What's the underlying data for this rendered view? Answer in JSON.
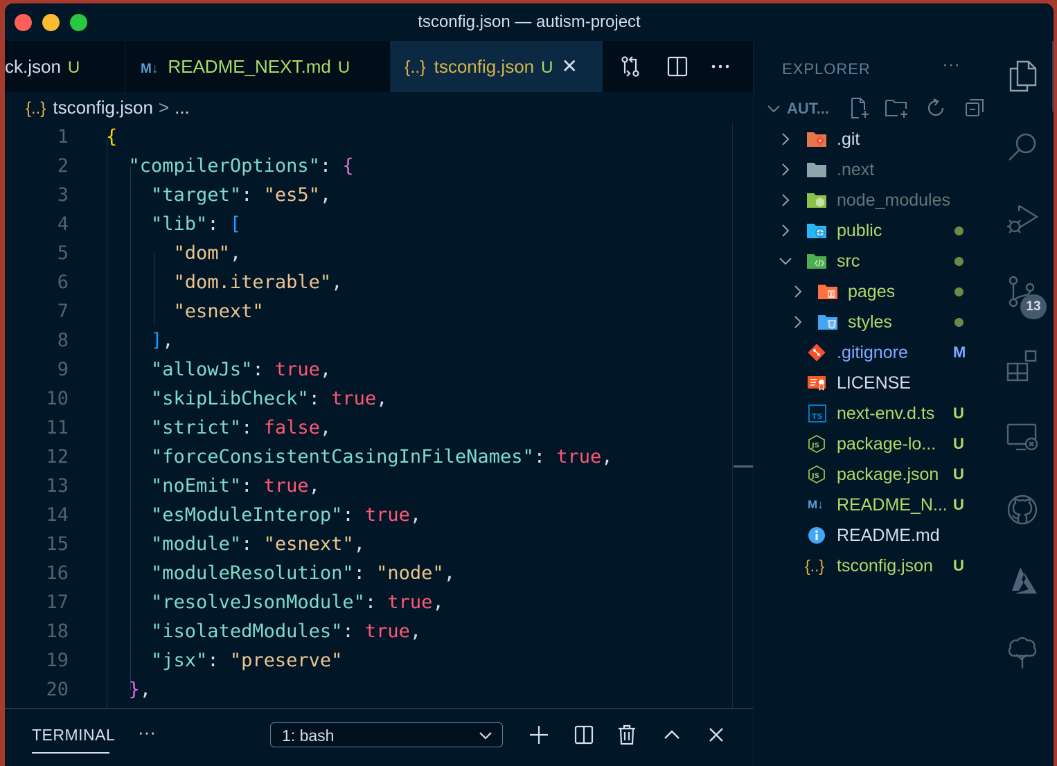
{
  "window": {
    "title": "tsconfig.json — autism-project"
  },
  "tabs": [
    {
      "label": "ck.json",
      "status": "U"
    },
    {
      "icon": "M↓",
      "label": "README_NEXT.md",
      "status": "U"
    },
    {
      "icon": "{..}",
      "label": "tsconfig.json",
      "status": "U",
      "active": true,
      "close": "✕"
    }
  ],
  "tab_actions": [
    "open-changes-icon",
    "split-editor-icon",
    "more-actions-icon"
  ],
  "breadcrumb": {
    "icon": "{..}",
    "file": "tsconfig.json",
    "separator": ">",
    "more": "..."
  },
  "editor": {
    "line_numbers": [
      "1",
      "2",
      "3",
      "4",
      "5",
      "6",
      "7",
      "8",
      "9",
      "10",
      "11",
      "12",
      "13",
      "14",
      "15",
      "16",
      "17",
      "18",
      "19",
      "20"
    ]
  },
  "terminal": {
    "tab_label": "TERMINAL",
    "more": "···",
    "selected_shell": "1: bash"
  },
  "explorer": {
    "title": "EXPLORER",
    "more": "···",
    "root_label": "AUT...",
    "items": [
      {
        "name": ".git",
        "type": "folder",
        "icon": "git-folder-icon",
        "color": "#d6deeb"
      },
      {
        "name": ".next",
        "type": "folder",
        "icon": "folder-icon",
        "color": "#637777"
      },
      {
        "name": "node_modules",
        "type": "folder",
        "icon": "node-folder-icon",
        "color": "#637777"
      },
      {
        "name": "public",
        "type": "folder",
        "icon": "public-folder-icon",
        "color": "#addb67",
        "dot": true
      },
      {
        "name": "src",
        "type": "folder",
        "icon": "src-folder-icon",
        "color": "#addb67",
        "dot": true,
        "expanded": true
      },
      {
        "name": "pages",
        "type": "folder",
        "icon": "pages-folder-icon",
        "color": "#addb67",
        "dot": true
      },
      {
        "name": "styles",
        "type": "folder",
        "icon": "styles-folder-icon",
        "color": "#addb67",
        "dot": true
      },
      {
        "name": ".gitignore",
        "type": "file",
        "icon": "git-icon",
        "color": "#82aaff",
        "badge": "M"
      },
      {
        "name": "LICENSE",
        "type": "file",
        "icon": "license-icon",
        "color": "#d6deeb"
      },
      {
        "name": "next-env.d.ts",
        "type": "file",
        "icon": "ts-icon",
        "color": "#addb67",
        "badge": "U"
      },
      {
        "name": "package-lo...",
        "type": "file",
        "icon": "node-icon",
        "color": "#addb67",
        "badge": "U"
      },
      {
        "name": "package.json",
        "type": "file",
        "icon": "node-icon",
        "color": "#addb67",
        "badge": "U"
      },
      {
        "name": "README_N...",
        "type": "file",
        "icon": "markdown-icon",
        "color": "#addb67",
        "badge": "U"
      },
      {
        "name": "README.md",
        "type": "file",
        "icon": "info-icon",
        "color": "#d6deeb"
      },
      {
        "name": "tsconfig.json",
        "type": "file",
        "icon": "json-icon",
        "color": "#addb67",
        "badge": "U"
      }
    ]
  },
  "activity_bar": {
    "scm_badge": "13"
  },
  "colors": {
    "background": "#011627",
    "untracked": "#addb67",
    "modified": "#82aaff",
    "string": "#ecc48d",
    "key": "#7fdbca",
    "boolean": "#ff5874"
  }
}
